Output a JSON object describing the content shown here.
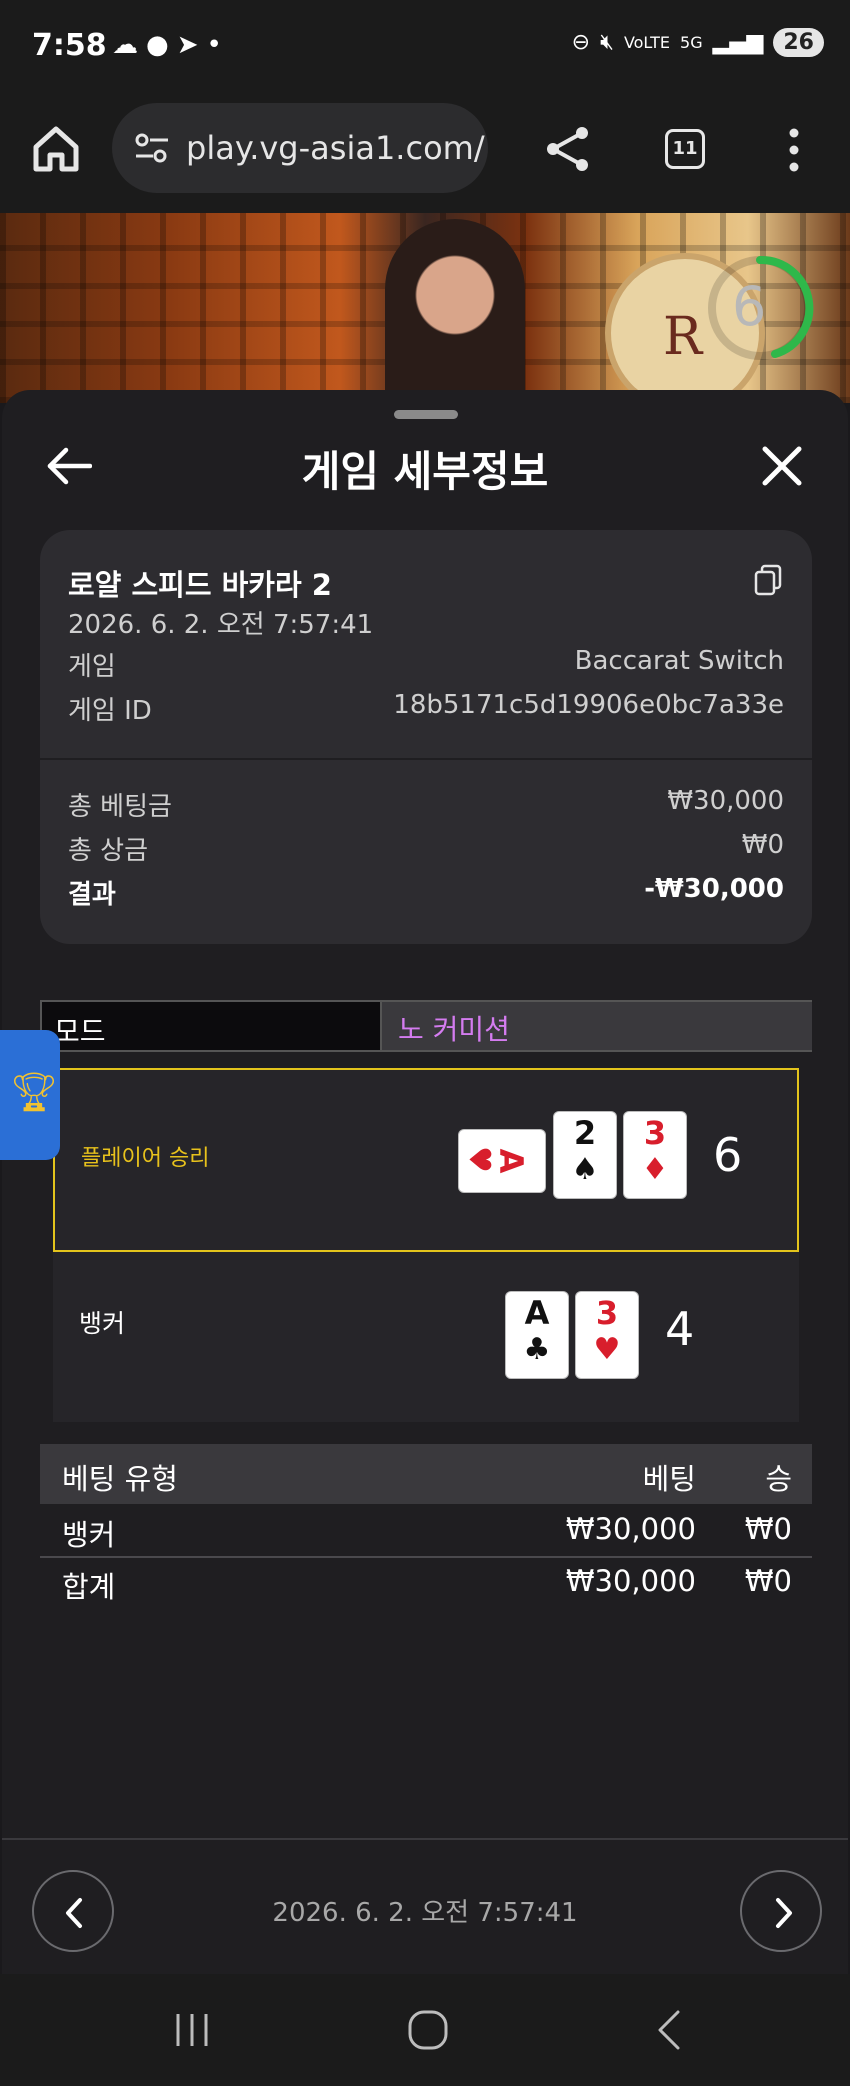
{
  "status_bar": {
    "time": "7:58",
    "left_icons": [
      "cloud-icon",
      "kakaotalk-icon",
      "telegram-icon",
      "dot-icon"
    ],
    "battery": "26"
  },
  "browser": {
    "url": "play.vg-asia1.com/",
    "tab_count": "11"
  },
  "video": {
    "timer_value": "6",
    "emblem_letter": "R"
  },
  "sheet": {
    "title": "게임 세부정보"
  },
  "game": {
    "name": "로얄 스피드 바카라 2",
    "datetime": "2026. 6. 2. 오전 7:57:41",
    "rows": [
      {
        "label": "게임",
        "value": "Baccarat Switch"
      },
      {
        "label": "게임 ID",
        "value": "18b5171c5d19906e0bc7a33e"
      }
    ],
    "totals": [
      {
        "label": "총 베팅금",
        "value": "₩30,000"
      },
      {
        "label": "총 상금",
        "value": "₩0"
      },
      {
        "label": "결과",
        "value": "-₩30,000"
      }
    ]
  },
  "mode": {
    "label": "모드",
    "value": "노 커미션"
  },
  "player": {
    "label": "플레이어 승리",
    "score": "6",
    "cards": [
      {
        "rank": "A",
        "suit": "♥",
        "color": "red",
        "rotated": true
      },
      {
        "rank": "2",
        "suit": "♠",
        "color": "black"
      },
      {
        "rank": "3",
        "suit": "♦",
        "color": "red"
      }
    ]
  },
  "banker": {
    "label": "뱅커",
    "score": "4",
    "cards": [
      {
        "rank": "A",
        "suit": "♣",
        "color": "black"
      },
      {
        "rank": "3",
        "suit": "♥",
        "color": "red"
      }
    ]
  },
  "bets": {
    "headers": [
      "베팅 유형",
      "베팅",
      "승"
    ],
    "rows": [
      [
        "뱅커",
        "₩30,000",
        "₩0"
      ],
      [
        "합계",
        "₩30,000",
        "₩0"
      ]
    ]
  },
  "footer": {
    "date": "2026. 6. 2. 오전 7:57:41"
  },
  "colors": {
    "highlight_border": "#e3c41c",
    "mode_value": "#d47cf0",
    "card_red": "#d81e2c",
    "timer_ring": "#2fb84a"
  }
}
